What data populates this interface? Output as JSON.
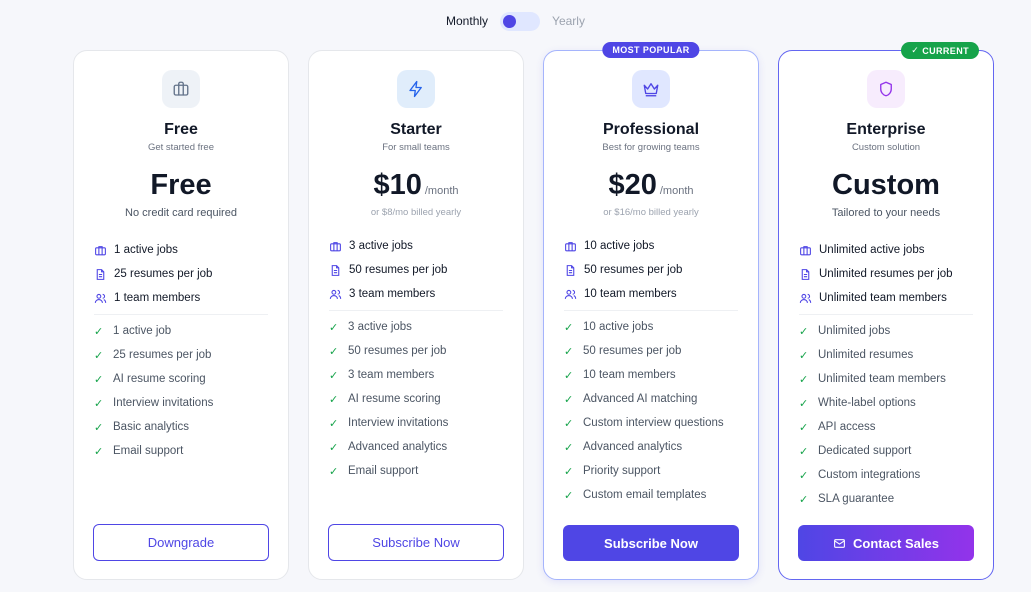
{
  "billing": {
    "monthly_label": "Monthly",
    "yearly_label": "Yearly"
  },
  "colors": {
    "accent": "#4f46e5",
    "success": "#16a34a",
    "purple": "#9333ea"
  },
  "plans": [
    {
      "name": "Free",
      "subtitle": "Get started free",
      "icon": "briefcase-icon",
      "price": "Free",
      "period": "",
      "note": "No credit card required",
      "limits": [
        "1 active jobs",
        "25 resumes per job",
        "1 team members"
      ],
      "features": [
        "1 active job",
        "25 resumes per job",
        "AI resume scoring",
        "Interview invitations",
        "Basic analytics",
        "Email support"
      ],
      "button": "Downgrade"
    },
    {
      "name": "Starter",
      "subtitle": "For small teams",
      "icon": "lightning-icon",
      "price": "$10",
      "period": "/month",
      "note": "or $8/mo billed yearly",
      "limits": [
        "3 active jobs",
        "50 resumes per job",
        "3 team members"
      ],
      "features": [
        "3 active jobs",
        "50 resumes per job",
        "3 team members",
        "AI resume scoring",
        "Interview invitations",
        "Advanced analytics",
        "Email support"
      ],
      "button": "Subscribe Now"
    },
    {
      "name": "Professional",
      "subtitle": "Best for growing teams",
      "icon": "crown-icon",
      "badge": "MOST POPULAR",
      "price": "$20",
      "period": "/month",
      "note": "or $16/mo billed yearly",
      "limits": [
        "10 active jobs",
        "50 resumes per job",
        "10 team members"
      ],
      "features": [
        "10 active jobs",
        "50 resumes per job",
        "10 team members",
        "Advanced AI matching",
        "Custom interview questions",
        "Advanced analytics",
        "Priority support",
        "Custom email templates"
      ],
      "button": "Subscribe Now"
    },
    {
      "name": "Enterprise",
      "subtitle": "Custom solution",
      "icon": "shield-icon",
      "badge": "CURRENT",
      "price": "Custom",
      "period": "",
      "note": "Tailored to your needs",
      "limits": [
        "Unlimited active jobs",
        "Unlimited resumes per job",
        "Unlimited team members"
      ],
      "features": [
        "Unlimited jobs",
        "Unlimited resumes",
        "Unlimited team members",
        "White-label options",
        "API access",
        "Dedicated support",
        "Custom integrations",
        "SLA guarantee"
      ],
      "button": "Contact Sales"
    }
  ]
}
